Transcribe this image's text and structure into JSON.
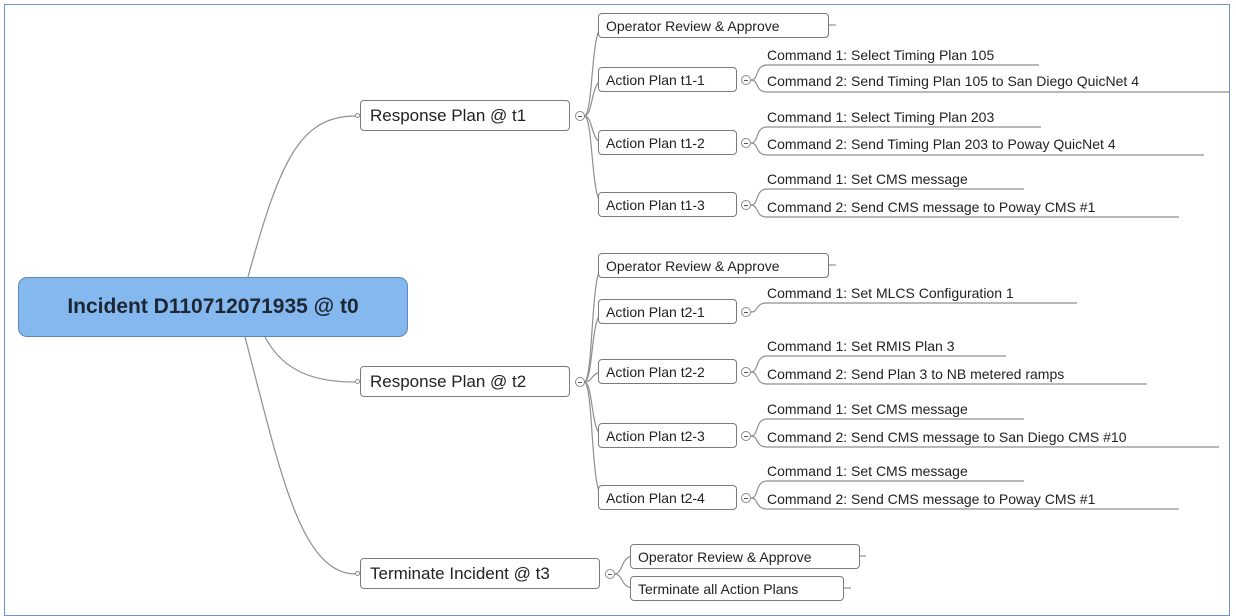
{
  "root": {
    "label": "Incident D110712071935 @ t0"
  },
  "plans": [
    {
      "label": "Response Plan @ t1",
      "review": "Operator Review & Approve",
      "actions": [
        {
          "label": "Action Plan t1-1",
          "commands": [
            "Command 1: Select Timing Plan 105",
            "Command 2: Send Timing Plan 105 to San Diego QuicNet 4"
          ]
        },
        {
          "label": "Action Plan t1-2",
          "commands": [
            "Command 1: Select Timing Plan 203",
            "Command 2: Send Timing Plan 203 to Poway QuicNet 4"
          ]
        },
        {
          "label": "Action Plan t1-3",
          "commands": [
            "Command 1: Set CMS message",
            "Command 2: Send CMS message to Poway CMS #1"
          ]
        }
      ]
    },
    {
      "label": "Response Plan @ t2",
      "review": "Operator Review & Approve",
      "actions": [
        {
          "label": "Action Plan t2-1",
          "commands": [
            "Command 1: Set MLCS Configuration 1"
          ]
        },
        {
          "label": "Action Plan t2-2",
          "commands": [
            "Command 1: Set RMIS Plan 3",
            "Command 2: Send Plan 3 to NB metered ramps"
          ]
        },
        {
          "label": "Action Plan t2-3",
          "commands": [
            "Command 1: Set CMS message",
            "Command 2: Send CMS message to San Diego CMS #10"
          ]
        },
        {
          "label": "Action Plan t2-4",
          "commands": [
            "Command 1: Set CMS message",
            "Command 2: Send CMS message to Poway CMS #1"
          ]
        }
      ]
    }
  ],
  "terminate": {
    "label": "Terminate Incident @ t3",
    "children": [
      "Operator Review & Approve",
      "Terminate all Action Plans"
    ]
  }
}
